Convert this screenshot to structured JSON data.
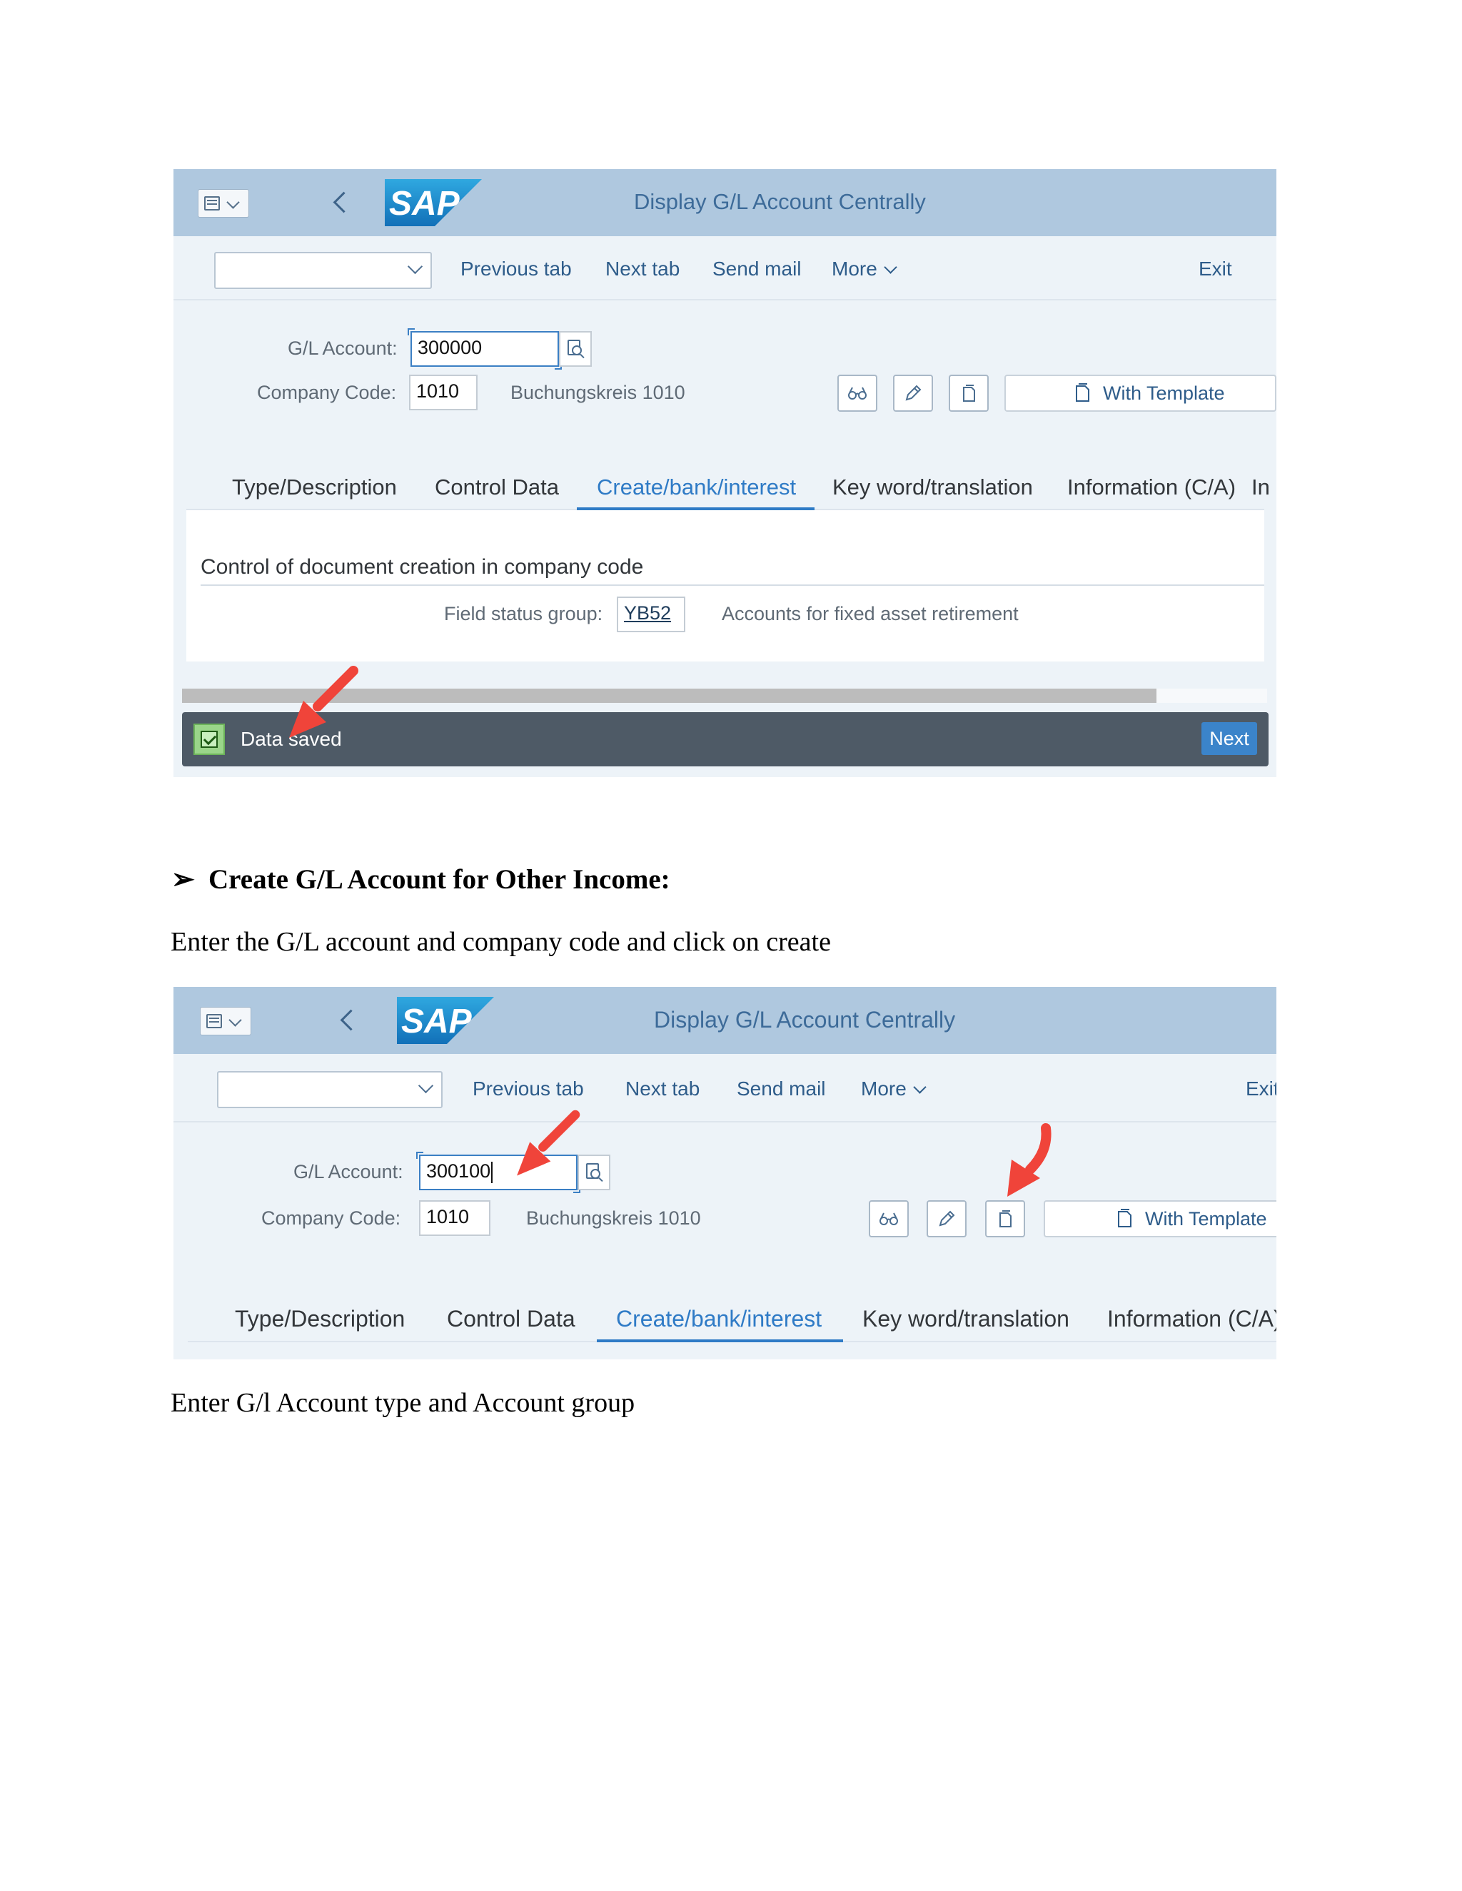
{
  "screen1": {
    "title": "Display G/L Account Centrally",
    "toolbar": {
      "previous_tab": "Previous tab",
      "next_tab": "Next tab",
      "send_mail": "Send mail",
      "more": "More",
      "exit": "Exit"
    },
    "fields": {
      "gl_account_label": "G/L Account:",
      "gl_account_value": "300000",
      "company_code_label": "Company Code:",
      "company_code_value": "1010",
      "company_code_text": "Buchungskreis 1010"
    },
    "with_template": "With Template",
    "tabs": [
      "Type/Description",
      "Control Data",
      "Create/bank/interest",
      "Key word/translation",
      "Information (C/A)",
      "In"
    ],
    "active_tab": "Create/bank/interest",
    "section_title": "Control of document creation in company code",
    "field_status_label": "Field status group:",
    "field_status_value": "YB52",
    "field_status_text": "Accounts for fixed asset retirement",
    "message": "Data saved",
    "next_button": "Next"
  },
  "heading": {
    "bullet": "➢",
    "text": "Create G/L Account for Other Income:"
  },
  "para1": "Enter the G/L account and company code and click on create",
  "screen2": {
    "title": "Display G/L Account Centrally",
    "toolbar": {
      "previous_tab": "Previous tab",
      "next_tab": "Next tab",
      "send_mail": "Send mail",
      "more": "More",
      "exit": "Exit"
    },
    "fields": {
      "gl_account_label": "G/L Account:",
      "gl_account_value": "300100",
      "company_code_label": "Company Code:",
      "company_code_value": "1010",
      "company_code_text": "Buchungskreis 1010"
    },
    "with_template": "With Template",
    "tabs": [
      "Type/Description",
      "Control Data",
      "Create/bank/interest",
      "Key word/translation",
      "Information (C/A)"
    ],
    "active_tab": "Create/bank/interest"
  },
  "para2": "Enter G/l Account type and Account group",
  "colors": {
    "header_bg": "#afc8df",
    "accent": "#2f7bc6",
    "message_bar": "#4e5a66",
    "arrow": "#f0443a"
  }
}
